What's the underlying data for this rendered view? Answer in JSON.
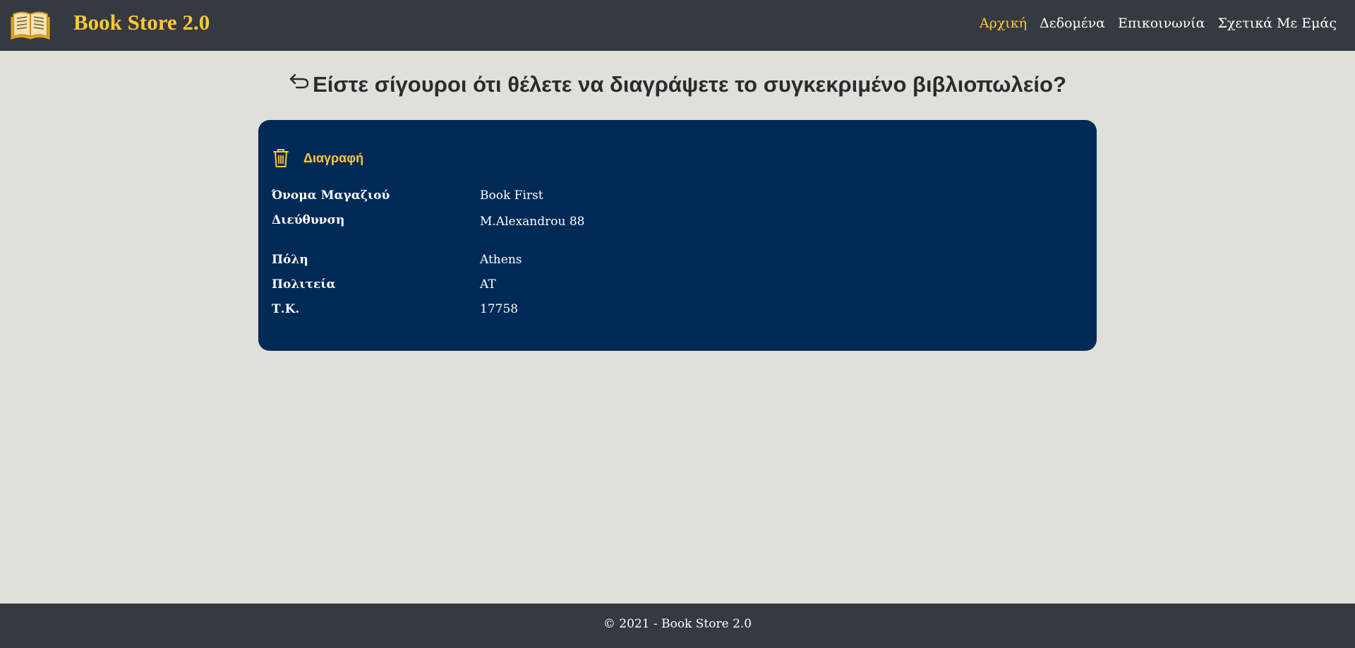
{
  "navbar": {
    "brand": "Book Store 2.0",
    "logo_icon": "open-book-icon",
    "links": [
      {
        "label": "Αρχική",
        "active": true
      },
      {
        "label": "Δεδομένα",
        "active": false
      },
      {
        "label": "Επικοινωνία",
        "active": false
      },
      {
        "label": "Σχετικά Με Εμάς",
        "active": false
      }
    ],
    "accent_color": "#ffc834",
    "background": "#343a40"
  },
  "page": {
    "title": "Είστε σίγουροι ότι θέλετε να διαγράψετε το συγκεκριμένο βιβλιοπωλείο?",
    "back_icon": "return-arrow-icon"
  },
  "card": {
    "delete_label": "Διαγραφή",
    "delete_icon": "trash-icon",
    "background": "#002a56",
    "fields": [
      {
        "label": "Όνομα Μαγαζιού",
        "value": "Book First"
      },
      {
        "label": "Διεύθυνση",
        "value": "M.Alexandrou 88"
      },
      {
        "label": "Πόλη",
        "value": "Athens"
      },
      {
        "label": "Πολιτεία",
        "value": "AT"
      },
      {
        "label": "Τ.Κ.",
        "value": "17758"
      }
    ]
  },
  "footer": {
    "text": "© 2021 - Book Store 2.0"
  }
}
